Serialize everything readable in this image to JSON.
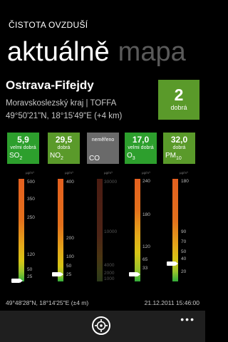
{
  "app": {
    "title": "ČISTOTA OVZDUŠÍ"
  },
  "pivot": {
    "active": "aktuálně",
    "next": "mapa"
  },
  "station": {
    "name": "Ostrava-Fifejdy",
    "region": "Moravskoslezský kraj | TOFFA",
    "coords": "49°50'21\"N, 18°15'49\"E (+4 km)"
  },
  "overall": {
    "index": "2",
    "label": "dobrá",
    "color": "#5a9a2a"
  },
  "pollutants": [
    {
      "value": "5,9",
      "quality": "velmi dobrá",
      "name": "SO",
      "sub": "2",
      "color": "#2d9f2d"
    },
    {
      "value": "29,5",
      "quality": "dobrá",
      "name": "NO",
      "sub": "2",
      "color": "#5a9a2a"
    },
    {
      "value": "",
      "quality": "neměřeno",
      "name": "CO",
      "sub": "",
      "color": "#6a6a6a"
    },
    {
      "value": "17,0",
      "quality": "velmi dobrá",
      "name": "O",
      "sub": "3",
      "color": "#2d9f2d"
    },
    {
      "value": "32,0",
      "quality": "dobrá",
      "name": "PM",
      "sub": "10",
      "color": "#5a9a2a"
    }
  ],
  "scales": [
    {
      "unit": "µg/m³",
      "ticks": [
        "500",
        "350",
        "250",
        "120",
        "50",
        "25"
      ],
      "pointer": 0.99
    },
    {
      "unit": "µg/m³",
      "ticks": [
        "400",
        "200",
        "100",
        "50",
        "25"
      ],
      "pointer": 0.93
    },
    {
      "unit": "µg/m³",
      "ticks": [
        "30000",
        "10000",
        "4000",
        "2000",
        "1000"
      ]
    },
    {
      "unit": "µg/m³",
      "ticks": [
        "240",
        "180",
        "120",
        "65",
        "33"
      ],
      "pointer": 0.93
    },
    {
      "unit": "µg/m³",
      "ticks": [
        "180",
        "90",
        "70",
        "50",
        "40",
        "20"
      ],
      "pointer": 0.83
    }
  ],
  "footer": {
    "coords": "49°48'28\"N, 18°14'25\"E (±4 m)",
    "datetime": "21.12.2011 15:46:00"
  },
  "appbar": {
    "more": "•••"
  }
}
